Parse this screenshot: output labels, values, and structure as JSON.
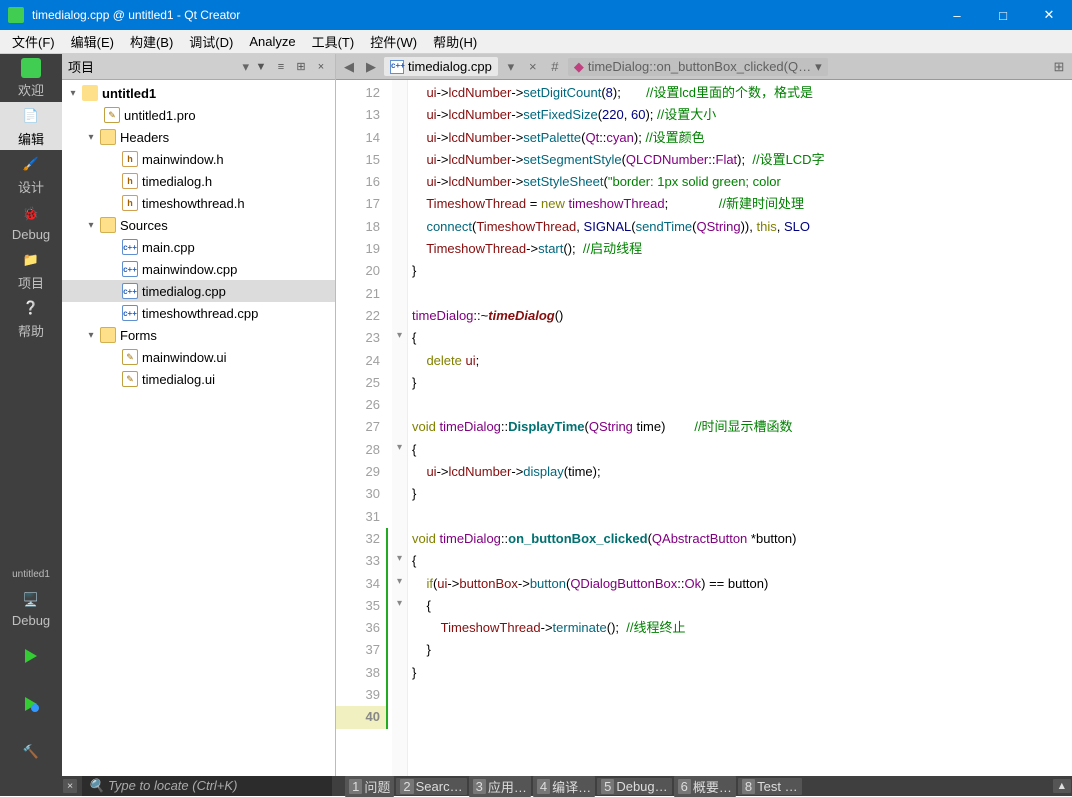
{
  "window": {
    "title": "timedialog.cpp @ untitled1 - Qt Creator"
  },
  "menus": [
    "文件(F)",
    "编辑(E)",
    "构建(B)",
    "调试(D)",
    "Analyze",
    "工具(T)",
    "控件(W)",
    "帮助(H)"
  ],
  "sidenav": {
    "welcome": "欢迎",
    "edit": "编辑",
    "design": "设计",
    "debug": "Debug",
    "projects": "项目",
    "help": "帮助",
    "kit": "untitled1",
    "debugmode": "Debug"
  },
  "projhdr": {
    "title": "项目"
  },
  "tree": {
    "root": "untitled1",
    "pro": "untitled1.pro",
    "headers": "Headers",
    "h0": "mainwindow.h",
    "h1": "timedialog.h",
    "h2": "timeshowthread.h",
    "sources": "Sources",
    "s0": "main.cpp",
    "s1": "mainwindow.cpp",
    "s2": "timedialog.cpp",
    "s3": "timeshowthread.cpp",
    "forms": "Forms",
    "f0": "mainwindow.ui",
    "f1": "timedialog.ui"
  },
  "tab": {
    "file": "timedialog.cpp",
    "crumb": "timeDialog::on_buttonBox_clicked(Q…"
  },
  "gutter": {
    "start": 12,
    "end": 40,
    "cur": 40
  },
  "code": {
    "l12": "        ui->lcdNumber->setDigitCount(8);       //设置lcd里面的个数，格式是",
    "l13": "        ui->lcdNumber->setFixedSize(220, 60); //设置大小",
    "l14": "        ui->lcdNumber->setPalette(Qt::cyan); //设置颜色",
    "l15": "        ui->lcdNumber->setSegmentStyle(QLCDNumber::Flat);  //设置LCD字",
    "l16": "        ui->lcdNumber->setStyleSheet(\"border: 1px solid green; color",
    "l17": "        TimeshowThread = new timeshowThread;              //新建时间处理",
    "l18": "        connect(TimeshowThread, SIGNAL(sendTime(QString)), this, SLO",
    "l19": "        TimeshowThread->start();  //启动线程",
    "l20": "    }",
    "l21": "",
    "l22": "    timeDialog::~timeDialog()",
    "l23": "    {",
    "l24": "        delete ui;",
    "l25": "    }",
    "l26": "",
    "l27": "    void timeDialog::DisplayTime(QString time)        //时间显示槽函数",
    "l28": "    {",
    "l29": "        ui->lcdNumber->display(time);",
    "l30": "    }",
    "l31": "",
    "l32": "    void timeDialog::on_buttonBox_clicked(QAbstractButton *button)",
    "l33": "    {",
    "l34": "        if(ui->buttonBox->button(QDialogButtonBox::Ok) == button)",
    "l35": "        {",
    "l36": "            TimeshowThread->terminate();  //线程终止",
    "l37": "        }",
    "l38": "    }",
    "l39": ""
  },
  "status": {
    "placeholder": "Type to locate (Ctrl+K)",
    "p1": "问题",
    "p2": "Searc…",
    "p3": "应用…",
    "p4": "编译…",
    "p5": "Debug…",
    "p6": "概要…",
    "p8": "Test …"
  }
}
